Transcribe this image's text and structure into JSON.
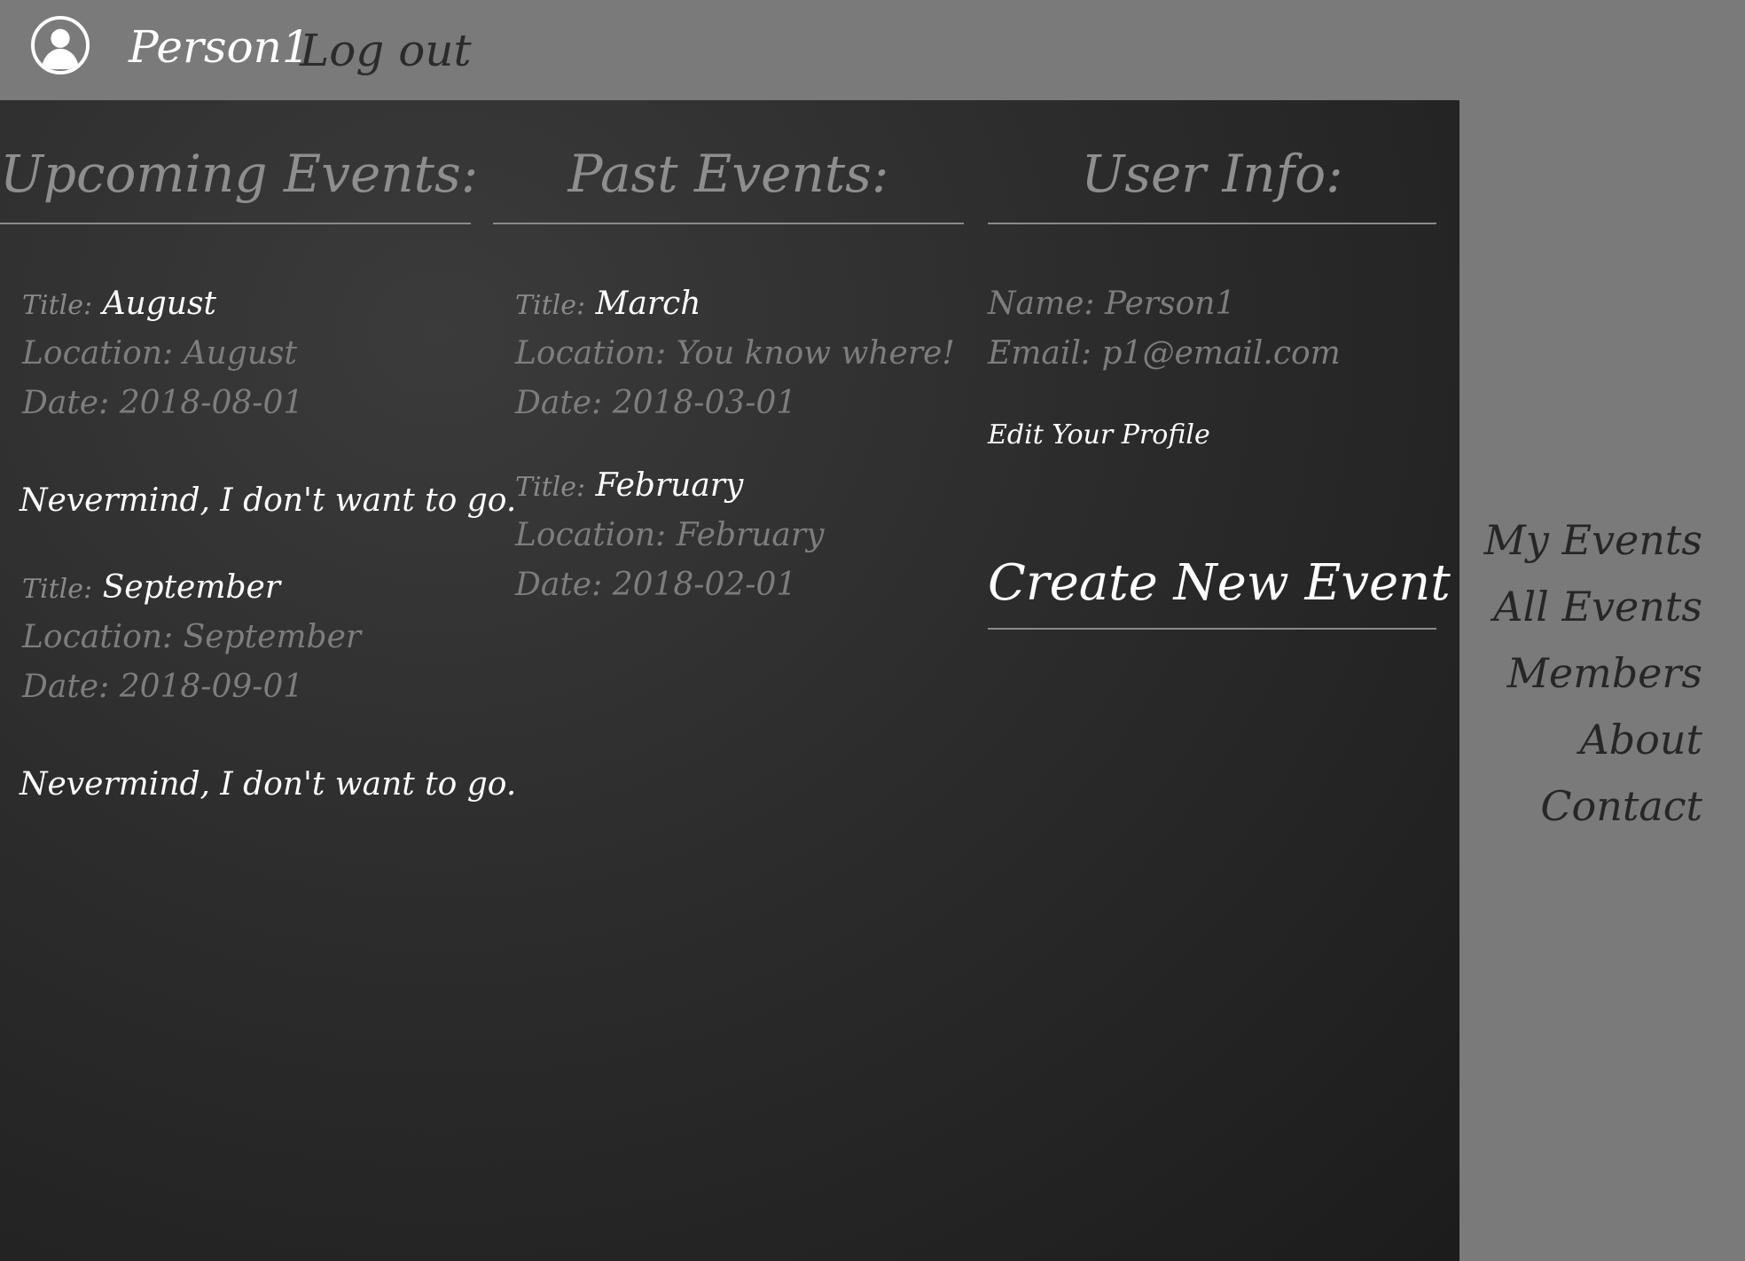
{
  "header": {
    "username": "Person1",
    "logout_label": "Log out"
  },
  "columns": {
    "upcoming": {
      "heading": "Upcoming Events:",
      "events": [
        {
          "title_label": "Title:",
          "title": "August",
          "location_label": "Location:",
          "location": "August",
          "date_label": "Date:",
          "date": "2018-08-01",
          "cancel_label": "Nevermind, I don't want to go."
        },
        {
          "title_label": "Title:",
          "title": "September",
          "location_label": "Location:",
          "location": "September",
          "date_label": "Date:",
          "date": "2018-09-01",
          "cancel_label": "Nevermind, I don't want to go."
        }
      ]
    },
    "past": {
      "heading": "Past Events:",
      "events": [
        {
          "title_label": "Title:",
          "title": "March",
          "location_label": "Location:",
          "location": "You know where!",
          "date_label": "Date:",
          "date": "2018-03-01"
        },
        {
          "title_label": "Title:",
          "title": "February",
          "location_label": "Location:",
          "location": "February",
          "date_label": "Date:",
          "date": "2018-02-01"
        }
      ]
    },
    "user": {
      "heading": "User Info:",
      "name_label": "Name:",
      "name": "Person1",
      "email_label": "Email:",
      "email": "p1@email.com",
      "edit_label": "Edit Your Profile",
      "create_label": "Create New Event"
    }
  },
  "sidenav": {
    "items": [
      {
        "label": "My Events"
      },
      {
        "label": "All Events"
      },
      {
        "label": "Members"
      },
      {
        "label": "About"
      },
      {
        "label": "Contact"
      }
    ]
  },
  "icons": {
    "avatar": "user-avatar-icon"
  },
  "colors": {
    "page_gray": "#7a7a7a",
    "panel_dark": "#2c2c2c",
    "muted_text": "#7d7d7d",
    "highlight_text": "#ffffff",
    "nav_text": "#262626"
  }
}
